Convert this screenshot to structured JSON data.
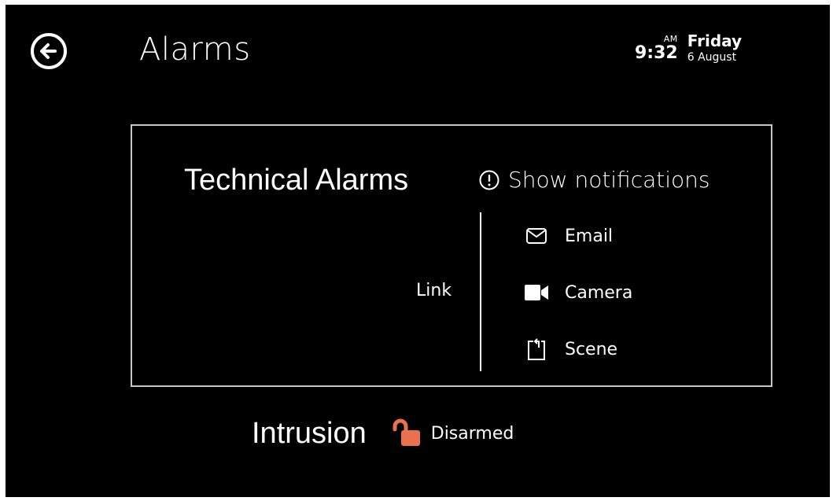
{
  "header": {
    "title": "Alarms",
    "back_icon": "back-arrow-circle-icon"
  },
  "clock": {
    "ampm": "AM",
    "time": "9:32",
    "day": "Friday",
    "date": "6 August"
  },
  "technical": {
    "title": "Technical Alarms",
    "notifications_label": "Show notifications",
    "notifications_icon": "alert-circle-icon",
    "link_label": "Link",
    "links": [
      {
        "label": "Email",
        "icon": "email-icon"
      },
      {
        "label": "Camera",
        "icon": "camera-icon"
      },
      {
        "label": "Scene",
        "icon": "scene-icon"
      }
    ]
  },
  "intrusion": {
    "title": "Intrusion",
    "status": "Disarmed",
    "status_icon": "unlocked-padlock-icon",
    "status_color": "#e9714f"
  }
}
